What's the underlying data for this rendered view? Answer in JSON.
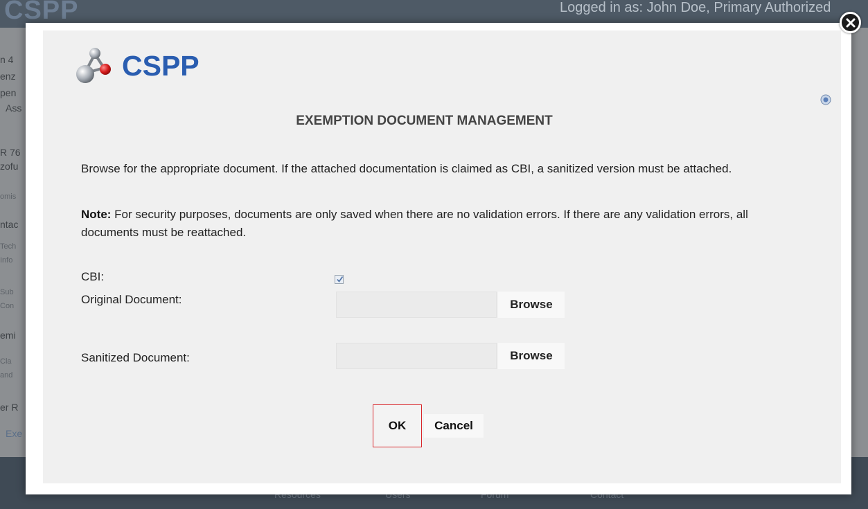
{
  "background": {
    "logo": "CSPP",
    "user_text": "Logged in as: John Doe, Primary Authorized",
    "side_fragments": [
      "n 4",
      "enz",
      "pen",
      "Ass",
      "R 76",
      "zofu",
      "omis",
      "ntac",
      "Tech",
      "Info",
      "Sub",
      "Con",
      "emi",
      "Cla",
      "and",
      "er R",
      "Exe"
    ],
    "footer_items": [
      "Resources",
      "Users",
      "Forum",
      "Contact"
    ]
  },
  "modal": {
    "logo_text": "CSPP",
    "title": "EXEMPTION DOCUMENT MANAGEMENT",
    "paragraph_1": "Browse for the appropriate document. If the attached documentation is claimed as CBI, a sanitized version must be attached.",
    "note_label": "Note:",
    "note_text": " For security purposes, documents are only saved when there are no validation errors. If there are any validation errors, all documents must be reattached.",
    "cbi_label": "CBI:",
    "cbi_checked": true,
    "original_label": "Original Document:",
    "original_value": "",
    "sanitized_label": "Sanitized Document:",
    "sanitized_value": "",
    "browse_label": "Browse",
    "ok_label": "OK",
    "cancel_label": "Cancel"
  },
  "icons": {
    "close": "close-icon",
    "help": "help-icon",
    "logo": "molecule-logo-icon",
    "check": "checkmark-icon"
  },
  "colors": {
    "logo_blue": "#2a5db0",
    "ok_focus_border": "#d9262b",
    "modal_bg": "#f0f0f0"
  }
}
